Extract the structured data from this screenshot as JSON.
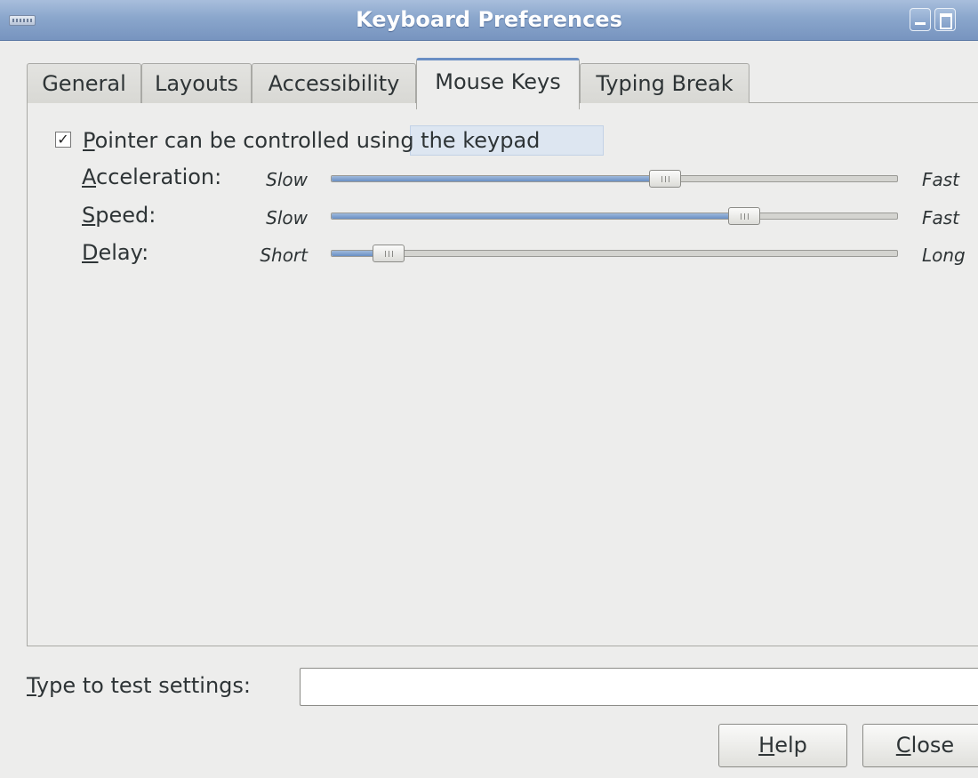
{
  "window": {
    "title": "Keyboard Preferences",
    "icons": {
      "app": "keyboard-icon",
      "minimize": "minimize-icon",
      "maximize": "maximize-icon"
    }
  },
  "tabs": [
    {
      "label": "General",
      "active": false
    },
    {
      "label": "Layouts",
      "active": false
    },
    {
      "label": "Accessibility",
      "active": false
    },
    {
      "label": "Mouse Keys",
      "active": true
    },
    {
      "label": "Typing Break",
      "active": false
    }
  ],
  "mouse_keys": {
    "pointer_checkbox": {
      "checked": true,
      "mnemonic": "P",
      "label_rest": "ointer can be controlled u",
      "label_tail": "sing the keypad"
    },
    "sliders": [
      {
        "mnemonic": "A",
        "label_rest": "cceleration:",
        "min_label": "Slow",
        "max_label": "Fast",
        "value_fraction": 0.59
      },
      {
        "mnemonic": "S",
        "label_rest": "peed:",
        "min_label": "Slow",
        "max_label": "Fast",
        "value_fraction": 0.73
      },
      {
        "mnemonic": "D",
        "label_rest": "elay:",
        "min_label": "Short",
        "max_label": "Long",
        "value_fraction": 0.1
      }
    ]
  },
  "test": {
    "mnemonic": "T",
    "label_rest": "ype to test settings:",
    "value": ""
  },
  "buttons": {
    "help": {
      "mnemonic": "H",
      "label_rest": "elp"
    },
    "close": {
      "mnemonic": "C",
      "label_rest": "lose"
    }
  },
  "colors": {
    "titlebar": "#8aa6cc",
    "accent": "#6a8fc4",
    "background": "#ededec"
  }
}
